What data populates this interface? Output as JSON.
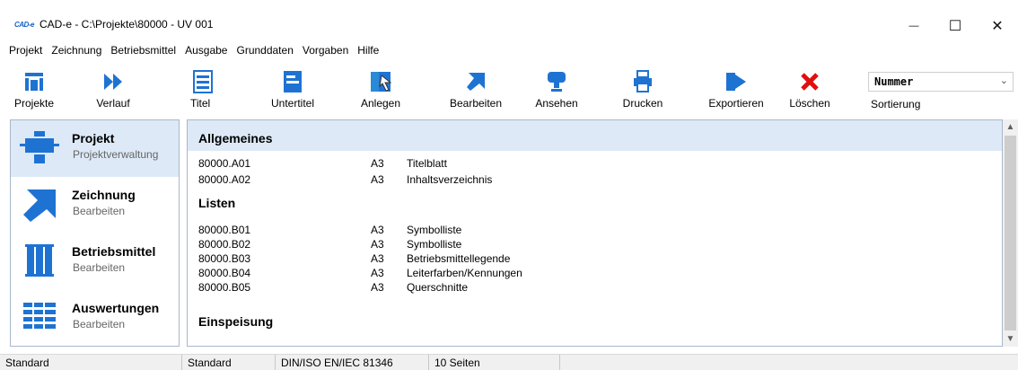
{
  "window": {
    "app_logo": "CAD‑e",
    "title": "CAD-e - C:\\Projekte\\80000 - UV 001",
    "minimize_glyph": "—",
    "maximize_glyph": "☐",
    "close_glyph": "✕"
  },
  "menu": {
    "items": [
      "Projekt",
      "Zeichnung",
      "Betriebsmittel",
      "Ausgabe",
      "Grunddaten",
      "Vorgaben",
      "Hilfe"
    ]
  },
  "toolbar": {
    "tools": [
      {
        "label": "Projekte",
        "icon": "projects-icon"
      },
      {
        "label": "Verlauf",
        "icon": "history-icon"
      },
      {
        "label": "Titel",
        "icon": "title-icon"
      },
      {
        "label": "Untertitel",
        "icon": "subtitle-icon"
      },
      {
        "label": "Anlegen",
        "icon": "create-icon"
      },
      {
        "label": "Bearbeiten",
        "icon": "edit-arrow-icon"
      },
      {
        "label": "Ansehen",
        "icon": "view-icon"
      },
      {
        "label": "Drucken",
        "icon": "printer-icon"
      },
      {
        "label": "Exportieren",
        "icon": "export-icon"
      },
      {
        "label": "Löschen",
        "icon": "delete-icon"
      }
    ],
    "sort": {
      "value": "Nummer",
      "label": "Sortierung"
    }
  },
  "colors": {
    "icon_blue": "#1e73d2",
    "delete_red": "#e01010",
    "highlight": "#dde9f6"
  },
  "nav": {
    "items": [
      {
        "title": "Projekt",
        "subtitle": "Projektverwaltung",
        "icon": "project-icon",
        "active": true
      },
      {
        "title": "Zeichnung",
        "subtitle": "Bearbeiten",
        "icon": "drawing-icon",
        "active": false
      },
      {
        "title": "Betriebsmittel",
        "subtitle": "Bearbeiten",
        "icon": "equipment-icon",
        "active": false
      },
      {
        "title": "Auswertungen",
        "subtitle": "Bearbeiten",
        "icon": "reports-icon",
        "active": false
      }
    ]
  },
  "list": {
    "groups": [
      {
        "title": "Allgemeines",
        "rows": [
          {
            "number": "80000.A01",
            "format": "A3",
            "name": "Titelblatt"
          },
          {
            "number": "80000.A02",
            "format": "A3",
            "name": "Inhaltsverzeichnis"
          }
        ]
      },
      {
        "title": "Listen",
        "rows": [
          {
            "number": "80000.B01",
            "format": "A3",
            "name": "Symbolliste"
          },
          {
            "number": "80000.B02",
            "format": "A3",
            "name": "Symbolliste"
          },
          {
            "number": "80000.B03",
            "format": "A3",
            "name": "Betriebsmittellegende"
          },
          {
            "number": "80000.B04",
            "format": "A3",
            "name": "Leiterfarben/Kennungen"
          },
          {
            "number": "80000.B05",
            "format": "A3",
            "name": "Querschnitte"
          }
        ]
      },
      {
        "title": "Einspeisung",
        "rows": []
      }
    ]
  },
  "status": {
    "segments": [
      "Standard",
      "Standard",
      "DIN/ISO EN/IEC 81346",
      "10 Seiten"
    ]
  }
}
